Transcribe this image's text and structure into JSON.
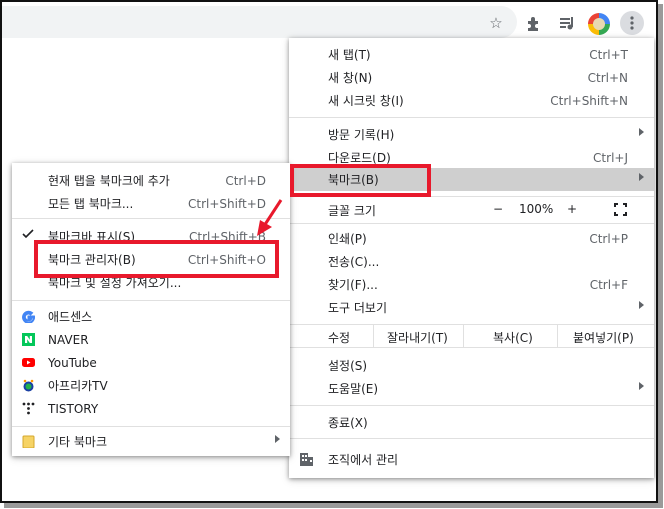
{
  "colors": {
    "highlight_box": "#e8192c",
    "hover_row": "#cfcfcf"
  },
  "toolbar": {
    "icons": [
      "star-icon",
      "extensions-icon",
      "reading-list-icon",
      "profile-avatar",
      "more-vert-icon"
    ]
  },
  "main_menu": {
    "items_top": [
      {
        "label": "새 탭(T)",
        "shortcut": "Ctrl+T"
      },
      {
        "label": "새 창(N)",
        "shortcut": "Ctrl+N"
      },
      {
        "label": "새 시크릿 창(I)",
        "shortcut": "Ctrl+Shift+N"
      }
    ],
    "items_history": [
      {
        "label": "방문 기록(H)",
        "shortcut": ""
      },
      {
        "label": "다운로드(D)",
        "shortcut": "Ctrl+J"
      },
      {
        "label": "북마크(B)",
        "shortcut": ""
      }
    ],
    "zoom": {
      "label": "글꼴 크기",
      "minus": "−",
      "value": "100%",
      "plus": "+"
    },
    "items_tools": [
      {
        "label": "인쇄(P)",
        "shortcut": "Ctrl+P"
      },
      {
        "label": "전송(C)...",
        "shortcut": ""
      },
      {
        "label": "찾기(F)...",
        "shortcut": "Ctrl+F"
      },
      {
        "label": "도구 더보기",
        "shortcut": ""
      }
    ],
    "edit": {
      "label": "수정",
      "cut": "잘라내기(T)",
      "copy": "복사(C)",
      "paste": "붙여넣기(P)"
    },
    "settings": "설정(S)",
    "help": "도움말(E)",
    "exit": "종료(X)",
    "managed": "조직에서 관리"
  },
  "bookmarks_menu": {
    "items_top": [
      {
        "label": "현재 탭을 북마크에 추가",
        "shortcut": "Ctrl+D"
      },
      {
        "label": "모든 탭 북마크...",
        "shortcut": "Ctrl+Shift+D"
      }
    ],
    "show_bar": {
      "label": "북마크바 표시(S)",
      "shortcut": "Ctrl+Shift+B",
      "checked": true
    },
    "manager": {
      "label": "북마크 관리자(B)",
      "shortcut": "Ctrl+Shift+O"
    },
    "import": {
      "label": "북마크 및 설정 가져오기..."
    },
    "bookmarks": [
      {
        "label": "애드센스",
        "icon": "google-icon"
      },
      {
        "label": "NAVER",
        "icon": "naver-icon"
      },
      {
        "label": "YouTube",
        "icon": "youtube-icon"
      },
      {
        "label": "아프리카TV",
        "icon": "afreecatv-icon"
      },
      {
        "label": "TISTORY",
        "icon": "tistory-icon"
      }
    ],
    "other": {
      "label": "기타 북마크",
      "icon": "folder-icon"
    }
  }
}
